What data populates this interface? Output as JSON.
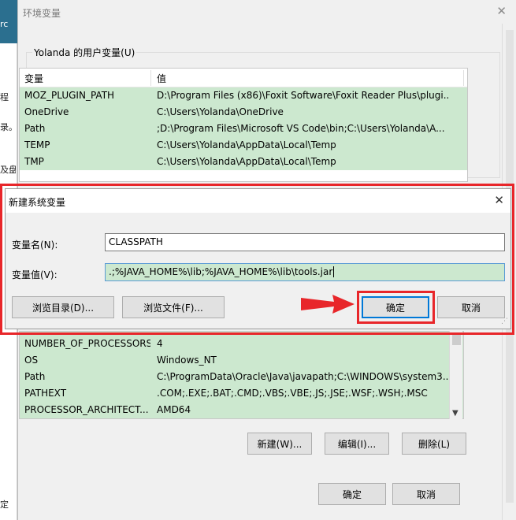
{
  "background_window": {
    "fragments": [
      "rc",
      "程",
      "录。",
      "及盘",
      "定"
    ]
  },
  "env_dialog": {
    "title": "环境变量",
    "user_group_label": "Yolanda 的用户变量(U)",
    "columns": [
      "变量",
      "值"
    ],
    "user_variables": [
      {
        "name": "MOZ_PLUGIN_PATH",
        "value": "D:\\Program Files (x86)\\Foxit Software\\Foxit Reader Plus\\plugi..."
      },
      {
        "name": "OneDrive",
        "value": "C:\\Users\\Yolanda\\OneDrive"
      },
      {
        "name": "Path",
        "value": ";D:\\Program Files\\Microsoft VS Code\\bin;C:\\Users\\Yolanda\\A..."
      },
      {
        "name": "TEMP",
        "value": "C:\\Users\\Yolanda\\AppData\\Local\\Temp"
      },
      {
        "name": "TMP",
        "value": "C:\\Users\\Yolanda\\AppData\\Local\\Temp"
      }
    ],
    "system_variables": [
      {
        "name": "NUMBER_OF_PROCESSORS",
        "value": "4"
      },
      {
        "name": "OS",
        "value": "Windows_NT"
      },
      {
        "name": "Path",
        "value": "C:\\ProgramData\\Oracle\\Java\\javapath;C:\\WINDOWS\\system3..."
      },
      {
        "name": "PATHEXT",
        "value": ".COM;.EXE;.BAT;.CMD;.VBS;.VBE;.JS;.JSE;.WSF;.WSH;.MSC"
      },
      {
        "name": "PROCESSOR_ARCHITECT...",
        "value": "AMD64"
      }
    ],
    "buttons": {
      "new": "新建(W)...",
      "edit": "编辑(I)...",
      "delete": "删除(L)",
      "ok": "确定",
      "cancel": "取消"
    }
  },
  "new_var_dialog": {
    "title": "新建系统变量",
    "name_label": "变量名(N):",
    "name_value": "CLASSPATH",
    "value_label": "变量值(V):",
    "value_value": ".;%JAVA_HOME%\\lib;%JAVA_HOME%\\lib\\tools.jar",
    "buttons": {
      "browse_dir": "浏览目录(D)...",
      "browse_file": "浏览文件(F)...",
      "ok": "确定",
      "cancel": "取消"
    }
  },
  "colors": {
    "annotation_red": "#e8262a",
    "selection_green": "#cce8cf"
  }
}
